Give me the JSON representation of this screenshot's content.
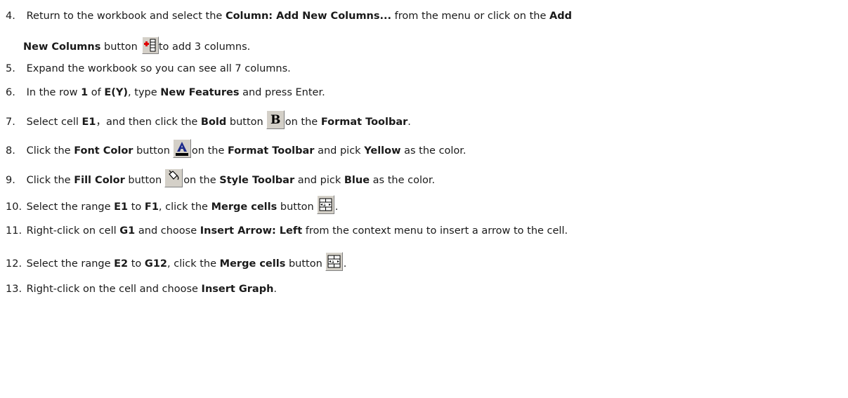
{
  "steps": [
    {
      "num": "4.",
      "line1": [
        {
          "t": "Return to the workbook and select the ",
          "b": false
        },
        {
          "t": "Column: Add New Columns...",
          "b": true
        },
        {
          "t": " from the menu or click on the ",
          "b": false
        },
        {
          "t": "Add",
          "b": true
        }
      ],
      "line2_bold": "New Columns",
      "line2_a": " button",
      "line2_b": "to add 3 columns.",
      "icon": "add-new-columns-icon"
    },
    {
      "num": "5.",
      "parts": [
        {
          "t": "Expand the workbook so you can see all 7 columns.",
          "b": false
        }
      ]
    },
    {
      "num": "6.",
      "parts": [
        {
          "t": "In the row ",
          "b": false
        },
        {
          "t": "1",
          "b": true
        },
        {
          "t": " of ",
          "b": false
        },
        {
          "t": "E(Y)",
          "b": true
        },
        {
          "t": ", type ",
          "b": false
        },
        {
          "t": "New Features",
          "b": true
        },
        {
          "t": " and press Enter.",
          "b": false
        }
      ]
    },
    {
      "num": "7.",
      "before": [
        {
          "t": "Select cell ",
          "b": false
        },
        {
          "t": "E1",
          "b": true
        },
        {
          "t": "，and then click the ",
          "b": false
        },
        {
          "t": "Bold",
          "b": true
        },
        {
          "t": " button",
          "b": false
        }
      ],
      "after": [
        {
          "t": "on the ",
          "b": false
        },
        {
          "t": "Format Toolbar",
          "b": true
        },
        {
          "t": ".",
          "b": false
        }
      ],
      "icon": "bold-icon"
    },
    {
      "num": "8.",
      "before": [
        {
          "t": "Click the ",
          "b": false
        },
        {
          "t": "Font Color",
          "b": true
        },
        {
          "t": " button",
          "b": false
        }
      ],
      "after": [
        {
          "t": "on the ",
          "b": false
        },
        {
          "t": "Format Toolbar",
          "b": true
        },
        {
          "t": " and pick ",
          "b": false
        },
        {
          "t": "Yellow",
          "b": true
        },
        {
          "t": " as the color.",
          "b": false
        }
      ],
      "icon": "font-color-icon"
    },
    {
      "num": "9.",
      "before": [
        {
          "t": "Click the ",
          "b": false
        },
        {
          "t": "Fill Color",
          "b": true
        },
        {
          "t": " button",
          "b": false
        }
      ],
      "after": [
        {
          "t": "on the ",
          "b": false
        },
        {
          "t": "Style Toolbar",
          "b": true
        },
        {
          "t": " and pick ",
          "b": false
        },
        {
          "t": "Blue",
          "b": true
        },
        {
          "t": " as the color.",
          "b": false
        }
      ],
      "icon": "fill-color-icon"
    },
    {
      "num": "10.",
      "before": [
        {
          "t": "Select the range ",
          "b": false
        },
        {
          "t": "E1",
          "b": true
        },
        {
          "t": " to ",
          "b": false
        },
        {
          "t": "F1",
          "b": true
        },
        {
          "t": ", click the ",
          "b": false
        },
        {
          "t": "Merge cells",
          "b": true
        },
        {
          "t": " button",
          "b": false
        }
      ],
      "after": [
        {
          "t": ".",
          "b": false
        }
      ],
      "icon": "merge-cells-icon"
    },
    {
      "num": "11.",
      "parts": [
        {
          "t": "Right-click on cell ",
          "b": false
        },
        {
          "t": "G1",
          "b": true
        },
        {
          "t": " and choose ",
          "b": false
        },
        {
          "t": "Insert Arrow: Left",
          "b": true
        },
        {
          "t": " from the context menu to insert a arrow to the cell.",
          "b": false
        }
      ]
    },
    {
      "num": "12.",
      "before": [
        {
          "t": "Select the range ",
          "b": false
        },
        {
          "t": "E2",
          "b": true
        },
        {
          "t": " to ",
          "b": false
        },
        {
          "t": "G12",
          "b": true
        },
        {
          "t": ", click the ",
          "b": false
        },
        {
          "t": "Merge cells",
          "b": true
        },
        {
          "t": " button",
          "b": false
        }
      ],
      "after": [
        {
          "t": ".",
          "b": false
        }
      ],
      "icon": "merge-cells-icon"
    },
    {
      "num": "13.",
      "parts": [
        {
          "t": "Right-click on the cell and choose ",
          "b": false
        },
        {
          "t": "Insert Graph",
          "b": true
        },
        {
          "t": ".",
          "b": false
        }
      ]
    }
  ]
}
